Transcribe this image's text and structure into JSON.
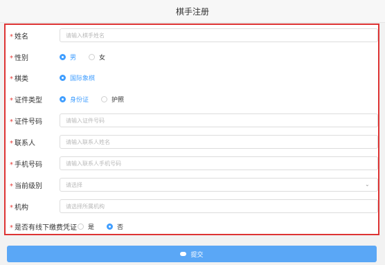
{
  "header": {
    "title": "棋手注册"
  },
  "form": {
    "name": {
      "label": "姓名",
      "placeholder": "请输入棋手姓名"
    },
    "gender": {
      "label": "性别",
      "options": [
        "男",
        "女"
      ],
      "selected": "男"
    },
    "chess_type": {
      "label": "棋类",
      "options": [
        "国际象棋"
      ],
      "selected": "国际象棋"
    },
    "id_type": {
      "label": "证件类型",
      "options": [
        "身份证",
        "护照"
      ],
      "selected": "身份证"
    },
    "id_number": {
      "label": "证件号码",
      "placeholder": "请输入证件号码"
    },
    "contact": {
      "label": "联系人",
      "placeholder": "请输入联系人姓名"
    },
    "phone": {
      "label": "手机号码",
      "placeholder": "请输入联系人手机号码"
    },
    "level": {
      "label": "当前级别",
      "placeholder": "请选择"
    },
    "org": {
      "label": "机构",
      "placeholder": "请选择所属机构"
    },
    "offline_receipt": {
      "label": "是否有线下缴费凭证",
      "options": [
        "是",
        "否"
      ],
      "selected": "否"
    }
  },
  "actions": {
    "submit_label": "提交"
  },
  "colors": {
    "accent": "#409eff",
    "required": "#e53935",
    "frame": "#dd3333",
    "submit_bg": "#5aa7f6"
  }
}
